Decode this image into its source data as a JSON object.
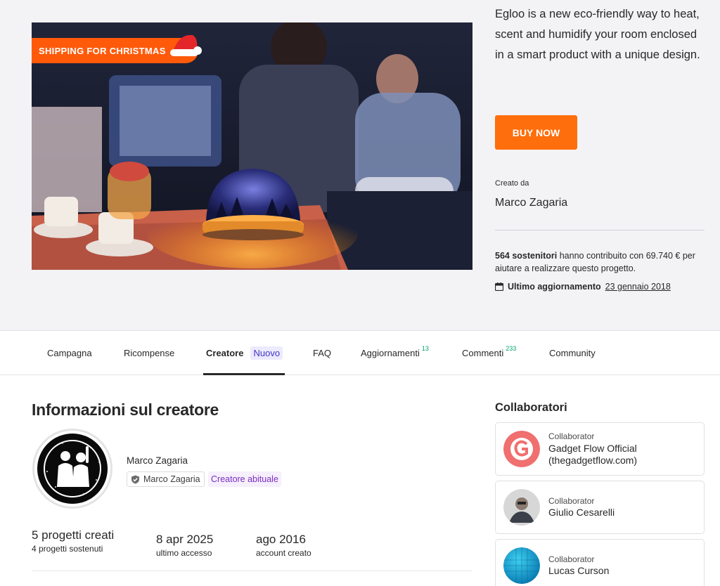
{
  "hero": {
    "ribbon_text": "SHIPPING FOR CHRISTMAS",
    "description": "Egloo is a new eco-friendly way to heat, scent and humidify your room enclosed in a smart product with a unique design.",
    "buy_label": "BUY NOW",
    "created_by_label": "Creato da",
    "creator_name": "Marco Zagaria",
    "backers_count": "564 sostenitori",
    "backers_text": " hanno contribuito con 69.740 € per aiutare a realizzare questo progetto.",
    "updated_label": "Ultimo aggiornamento",
    "updated_date": "23 gennaio 2018",
    "accent_color": "#ff6e0c"
  },
  "tabs": [
    {
      "label": "Campagna"
    },
    {
      "label": "Ricompense"
    },
    {
      "label": "Creatore",
      "badge": "Nuovo",
      "active": true
    },
    {
      "label": "FAQ"
    },
    {
      "label": "Aggiornamenti",
      "count": "13"
    },
    {
      "label": "Commenti",
      "count": "233"
    },
    {
      "label": "Community"
    }
  ],
  "creator": {
    "section_title": "Informazioni sul creatore",
    "name": "Marco Zagaria",
    "verified_name": "Marco Zagaria",
    "regular_badge": "Creatore abituale",
    "stats": [
      {
        "big": "5 progetti creati",
        "small": "4 progetti sostenuti"
      },
      {
        "big": "8 apr 2025",
        "small": "ultimo accesso"
      },
      {
        "big": "ago 2016",
        "small": "account creato"
      }
    ]
  },
  "collaborators": {
    "title": "Collaboratori",
    "items": [
      {
        "role": "Collaborator",
        "name": "Gadget Flow Official (thegadgetflow.com)",
        "icon": "gadget-flow-logo"
      },
      {
        "role": "Collaborator",
        "name": "Giulio Cesarelli",
        "icon": "person-photo"
      },
      {
        "role": "Collaborator",
        "name": "Lucas Curson",
        "icon": "blue-sphere-logo"
      }
    ]
  }
}
